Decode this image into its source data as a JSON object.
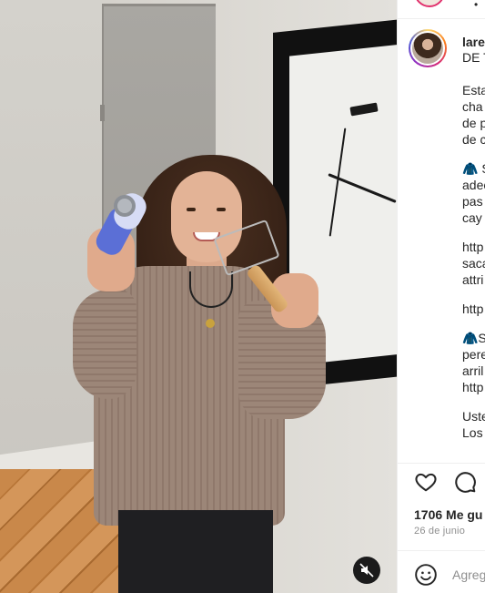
{
  "post": {
    "username": "lare",
    "username_cont": "DE T",
    "caption_lines": [
      "Esta",
      "cha",
      "de p",
      "de c",
      "",
      "🧥 S",
      "adec",
      "pas",
      "cay",
      "",
      "http",
      "saca",
      "attri",
      "",
      "http",
      "",
      "🧥S",
      "pere",
      "arril",
      "http",
      "",
      "Uste",
      "Los"
    ],
    "likes_text": "1706 Me gu",
    "date_text": "26 de junio",
    "comment_placeholder": "Agreg"
  },
  "icons": {
    "like": "heart-icon",
    "comment": "comment-icon",
    "emoji": "emoji-icon",
    "mute": "speaker-muted-icon"
  },
  "colors": {
    "story_ring": "#e1306c",
    "text": "#262626",
    "muted_text": "#8e8e8e"
  }
}
